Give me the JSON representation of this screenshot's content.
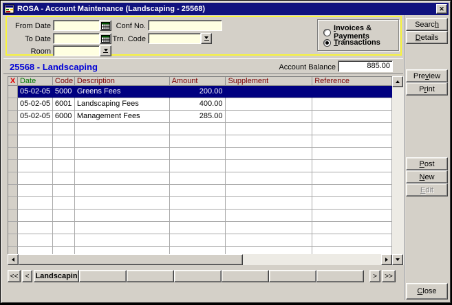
{
  "window": {
    "title": "ROSA - Account Maintenance (Landscaping - 25568)"
  },
  "icons": {
    "close": "✕"
  },
  "filter": {
    "from_date_label": "From Date",
    "from_date_value": "",
    "to_date_label": "To Date",
    "to_date_value": "",
    "room_label": "Room",
    "room_value": "",
    "conf_no_label": "Conf No.",
    "conf_no_value": "",
    "trn_code_label": "Trn. Code",
    "trn_code_value": "",
    "radio_invoices_label": "Invoices & Payments",
    "radio_transactions_label": "Transactions",
    "selected_radio_key": "transactions"
  },
  "account": {
    "heading": "25568 - Landscaping",
    "balance_label": "Account Balance",
    "balance_value": "885.00"
  },
  "table": {
    "columns": [
      "X",
      "Date",
      "Code",
      "Description",
      "Amount",
      "Supplement",
      "Reference"
    ],
    "rows": [
      {
        "date": "05-02-05",
        "code": "5000",
        "description": "Greens Fees",
        "amount": "200.00",
        "supplement": "",
        "reference": "",
        "selected": true
      },
      {
        "date": "05-02-05",
        "code": "6001",
        "description": "Landscaping Fees",
        "amount": "400.00",
        "supplement": "",
        "reference": "",
        "selected": false
      },
      {
        "date": "05-02-05",
        "code": "6000",
        "description": "Management Fees",
        "amount": "285.00",
        "supplement": "",
        "reference": "",
        "selected": false
      }
    ],
    "empty_row_count": 11
  },
  "buttons": {
    "search": "Search",
    "details": "Details",
    "preview": "Preview",
    "print": "Print",
    "post": "Post",
    "new": "New",
    "edit": "Edit",
    "close": "Close"
  },
  "pager": {
    "first": "<<",
    "prev": "<",
    "active_tab": "Landscapin",
    "empty_tab_count": 6,
    "next": ">",
    "last": ">>"
  },
  "colors": {
    "titlebar": "#10127E",
    "selection": "#000080",
    "field_bg": "#FFFFE1",
    "frame_yellow": "#F8F43B",
    "heading_blue": "#0000D6",
    "header_maroon": "#7C0000",
    "header_green": "#007800",
    "header_red": "#E00000"
  }
}
